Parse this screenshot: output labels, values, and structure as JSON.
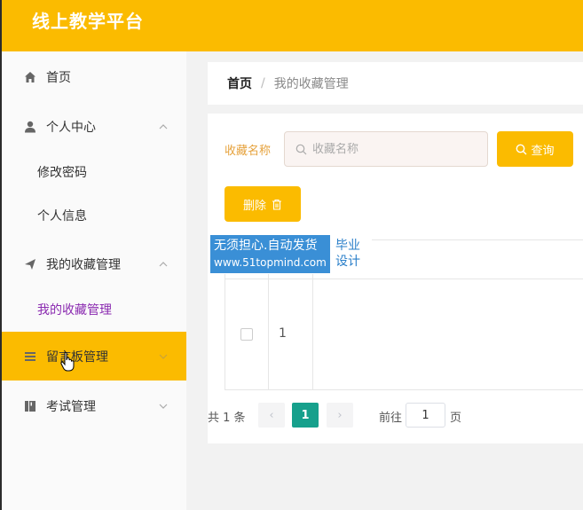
{
  "app": {
    "title": "线上教学平台"
  },
  "sidebar": {
    "items": [
      {
        "label": "首页",
        "icon": "home-icon"
      },
      {
        "label": "个人中心",
        "icon": "user-icon",
        "expanded": true,
        "children": [
          {
            "label": "修改密码"
          },
          {
            "label": "个人信息"
          }
        ]
      },
      {
        "label": "我的收藏管理",
        "icon": "send-icon",
        "expanded": true,
        "children": [
          {
            "label": "我的收藏管理",
            "active": true
          }
        ]
      },
      {
        "label": "留言板管理",
        "icon": "menu-icon",
        "hovered": true
      },
      {
        "label": "考试管理",
        "icon": "book-icon"
      }
    ]
  },
  "breadcrumb": {
    "home": "首页",
    "separator": "/",
    "current": "我的收藏管理"
  },
  "search": {
    "label": "收藏名称",
    "placeholder": "收藏名称",
    "button": "查询"
  },
  "actions": {
    "delete": "删除"
  },
  "table": {
    "rows": [
      {
        "index": "1"
      }
    ]
  },
  "pagination": {
    "total": "共 1 条",
    "prev": "‹",
    "page": "1",
    "next": "›",
    "goto": "前往",
    "goto_value": "1",
    "unit": "页"
  },
  "watermark": {
    "line1": "无须担心.自动发货",
    "line2": "www.51topmind.com",
    "side1": "毕业",
    "side2": "设计"
  },
  "colors": {
    "accent": "#fbbb00",
    "active_page": "#16a08c",
    "active_sub": "#8a2ab0"
  }
}
